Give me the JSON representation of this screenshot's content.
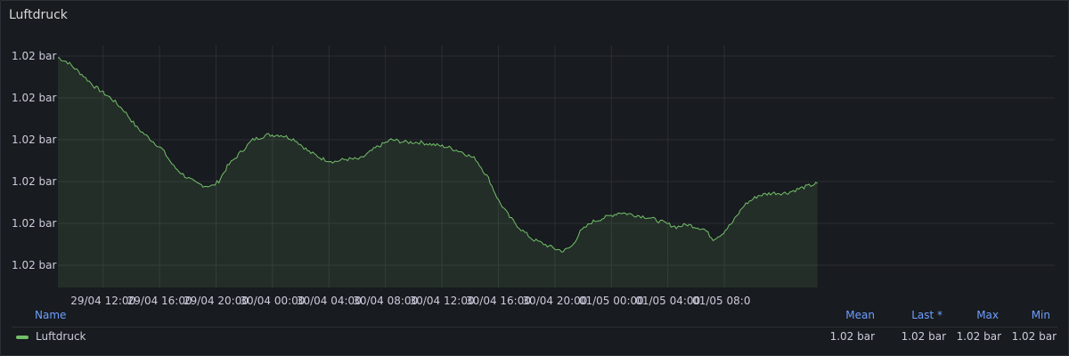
{
  "panel": {
    "title": "Luftdruck"
  },
  "colors": {
    "series": "#73bf69",
    "grid": "#2b2e34",
    "legend_header": "#6e9fff"
  },
  "chart_data": {
    "type": "area",
    "title": "Luftdruck",
    "y_tick_labels": [
      "1.02 bar",
      "1.02 bar",
      "1.02 bar",
      "1.02 bar",
      "1.02 bar",
      "1.02 bar"
    ],
    "y_range_relative": [
      0,
      100
    ],
    "x_tick_labels": [
      "29/04 12:00",
      "29/04 16:00",
      "29/04 20:00",
      "30/04 00:00",
      "30/04 04:00",
      "30/04 08:00",
      "30/04 12:00",
      "30/04 16:00",
      "30/04 20:00",
      "01/05 00:00",
      "01/05 04:00",
      "01/05 08:0"
    ],
    "x_hours_range": [
      -3.2,
      67.4
    ],
    "x_tick_hours": [
      0,
      4,
      8,
      12,
      16,
      20,
      24,
      28,
      32,
      36,
      40,
      44
    ],
    "series": [
      {
        "name": "Luftdruck",
        "points_hours_relvalue": [
          [
            -3.2,
            95
          ],
          [
            -2.5,
            93
          ],
          [
            -1.5,
            88
          ],
          [
            -0.6,
            83
          ],
          [
            0.6,
            78
          ],
          [
            1.5,
            73
          ],
          [
            2.4,
            66
          ],
          [
            3.2,
            62
          ],
          [
            4.2,
            57
          ],
          [
            5.0,
            50
          ],
          [
            5.8,
            46
          ],
          [
            6.6,
            43
          ],
          [
            7.2,
            42
          ],
          [
            7.8,
            42
          ],
          [
            8.2,
            44
          ],
          [
            8.8,
            50
          ],
          [
            9.6,
            55
          ],
          [
            10.6,
            61
          ],
          [
            11.6,
            63
          ],
          [
            12.6,
            63
          ],
          [
            13.6,
            61
          ],
          [
            14.6,
            56
          ],
          [
            15.6,
            53
          ],
          [
            16.4,
            52
          ],
          [
            17.2,
            53
          ],
          [
            18.2,
            53
          ],
          [
            19.4,
            58
          ],
          [
            20.4,
            61
          ],
          [
            21.4,
            60
          ],
          [
            22.4,
            60
          ],
          [
            23.4,
            59
          ],
          [
            24.4,
            58
          ],
          [
            25.4,
            56
          ],
          [
            26.4,
            53
          ],
          [
            27.3,
            45
          ],
          [
            28.0,
            36
          ],
          [
            28.8,
            29
          ],
          [
            29.6,
            24
          ],
          [
            30.4,
            20
          ],
          [
            31.2,
            18
          ],
          [
            32.0,
            16
          ],
          [
            32.6,
            15
          ],
          [
            33.2,
            17
          ],
          [
            33.8,
            23
          ],
          [
            34.6,
            27
          ],
          [
            35.6,
            29
          ],
          [
            36.6,
            31
          ],
          [
            37.6,
            30
          ],
          [
            38.6,
            29
          ],
          [
            39.6,
            27
          ],
          [
            40.6,
            25
          ],
          [
            41.4,
            26
          ],
          [
            42.6,
            24
          ],
          [
            43.2,
            20
          ],
          [
            43.8,
            22
          ],
          [
            44.6,
            27
          ],
          [
            45.4,
            34
          ],
          [
            46.4,
            38
          ],
          [
            47.4,
            39
          ],
          [
            48.4,
            39
          ],
          [
            49.4,
            41
          ],
          [
            50.6,
            43
          ]
        ]
      }
    ],
    "legend": {
      "columns": [
        "Name",
        "Mean",
        "Last *",
        "Max",
        "Min"
      ],
      "rows": [
        {
          "name": "Luftdruck",
          "mean": "1.02 bar",
          "last": "1.02 bar",
          "max": "1.02 bar",
          "min": "1.02 bar"
        }
      ]
    }
  }
}
